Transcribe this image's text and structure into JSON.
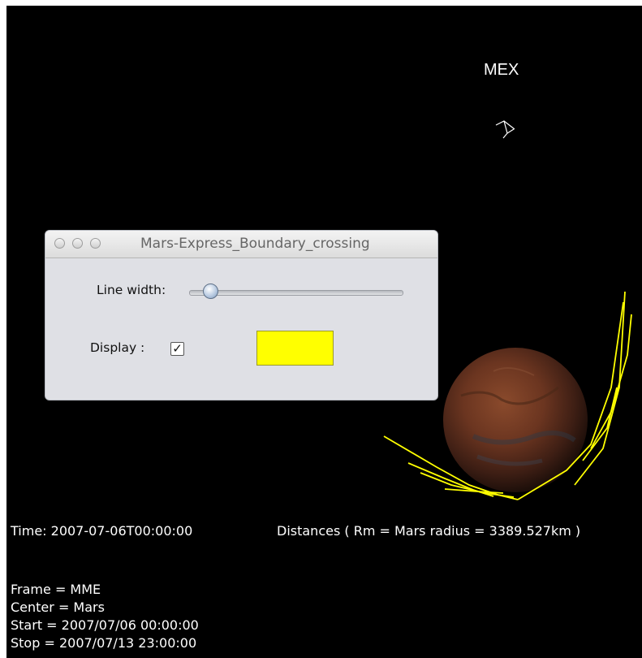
{
  "scene": {
    "spacecraft_label": "MEX",
    "boundary_color": "#ffff00",
    "background_color": "#000000"
  },
  "dialog": {
    "title": "Mars-Express_Boundary_crossing",
    "line_width_label": "Line width:",
    "line_width_value": 0.1,
    "display_label": "Display :",
    "display_checked": true,
    "display_check_glyph": "✓",
    "color": "#ffff00",
    "window_buttons": [
      "close-icon",
      "minimize-icon",
      "zoom-icon"
    ]
  },
  "info": {
    "time": "Time: 2007-07-06T00:00:00",
    "distances": "Distances ( Rm = Mars radius = 3389.527km )",
    "frame": "Frame = MME",
    "center": "Center = Mars",
    "start": "Start = 2007/07/06 00:00:00",
    "stop": "Stop = 2007/07/13 23:00:00"
  }
}
